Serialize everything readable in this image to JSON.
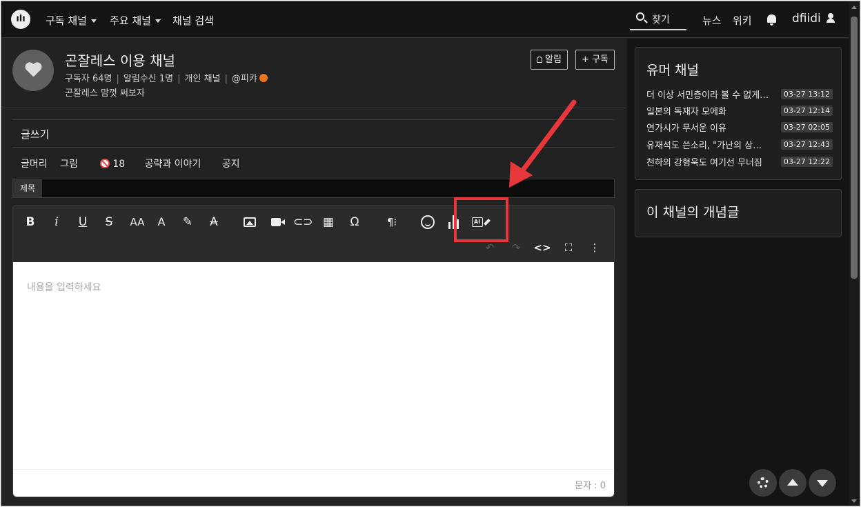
{
  "nav": {
    "items": [
      "구독 채널",
      "주요 채널",
      "채널 검색"
    ],
    "search_label": "찾기",
    "links": [
      "뉴스",
      "위키"
    ],
    "username": "dfiidi"
  },
  "channel": {
    "title": "곤잘레스 이용 채널",
    "subscribers": "구독자 64명",
    "notify_count": "알림수신 1명",
    "channel_type": "개인 채널",
    "owner": "@피캬",
    "description": "곤잘레스 맘껏 써보자",
    "notify_button": "알림",
    "subscribe_button": "+ 구독"
  },
  "write": {
    "title": "글쓰기",
    "categories": [
      "글머리",
      "그림",
      "18",
      "공략과 이야기",
      "공지"
    ],
    "subject_label": "제목",
    "subject_value": "",
    "toolbar": {
      "bold": "B",
      "italic": "i",
      "underline": "U",
      "strike": "S",
      "font_size": "AA",
      "paragraph": "¶⁝",
      "special_char": "Ω",
      "code": "<>",
      "more": "⋮"
    },
    "placeholder": "내용을 입력하세요",
    "char_count": "문자 : 0"
  },
  "sidebar": {
    "humor_title": "유머 채널",
    "posts": [
      {
        "title": "더 이상 서민층이라 볼 수 없게…",
        "time": "03-27 13:12"
      },
      {
        "title": "일본의 독재자 모에화",
        "time": "03-27 12:14"
      },
      {
        "title": "연가시가 무서운 이유",
        "time": "03-27 02:05"
      },
      {
        "title": "유재석도 쓴소리, \"가난의 상…",
        "time": "03-27 12:43"
      },
      {
        "title": "천하의 강형욱도 여기선 무너짐",
        "time": "03-27 12:22"
      }
    ],
    "concept_title": "이 채널의 개념글"
  },
  "colors": {
    "highlight": "#e8373a",
    "verified": "#e8741c",
    "background": "#222222"
  }
}
